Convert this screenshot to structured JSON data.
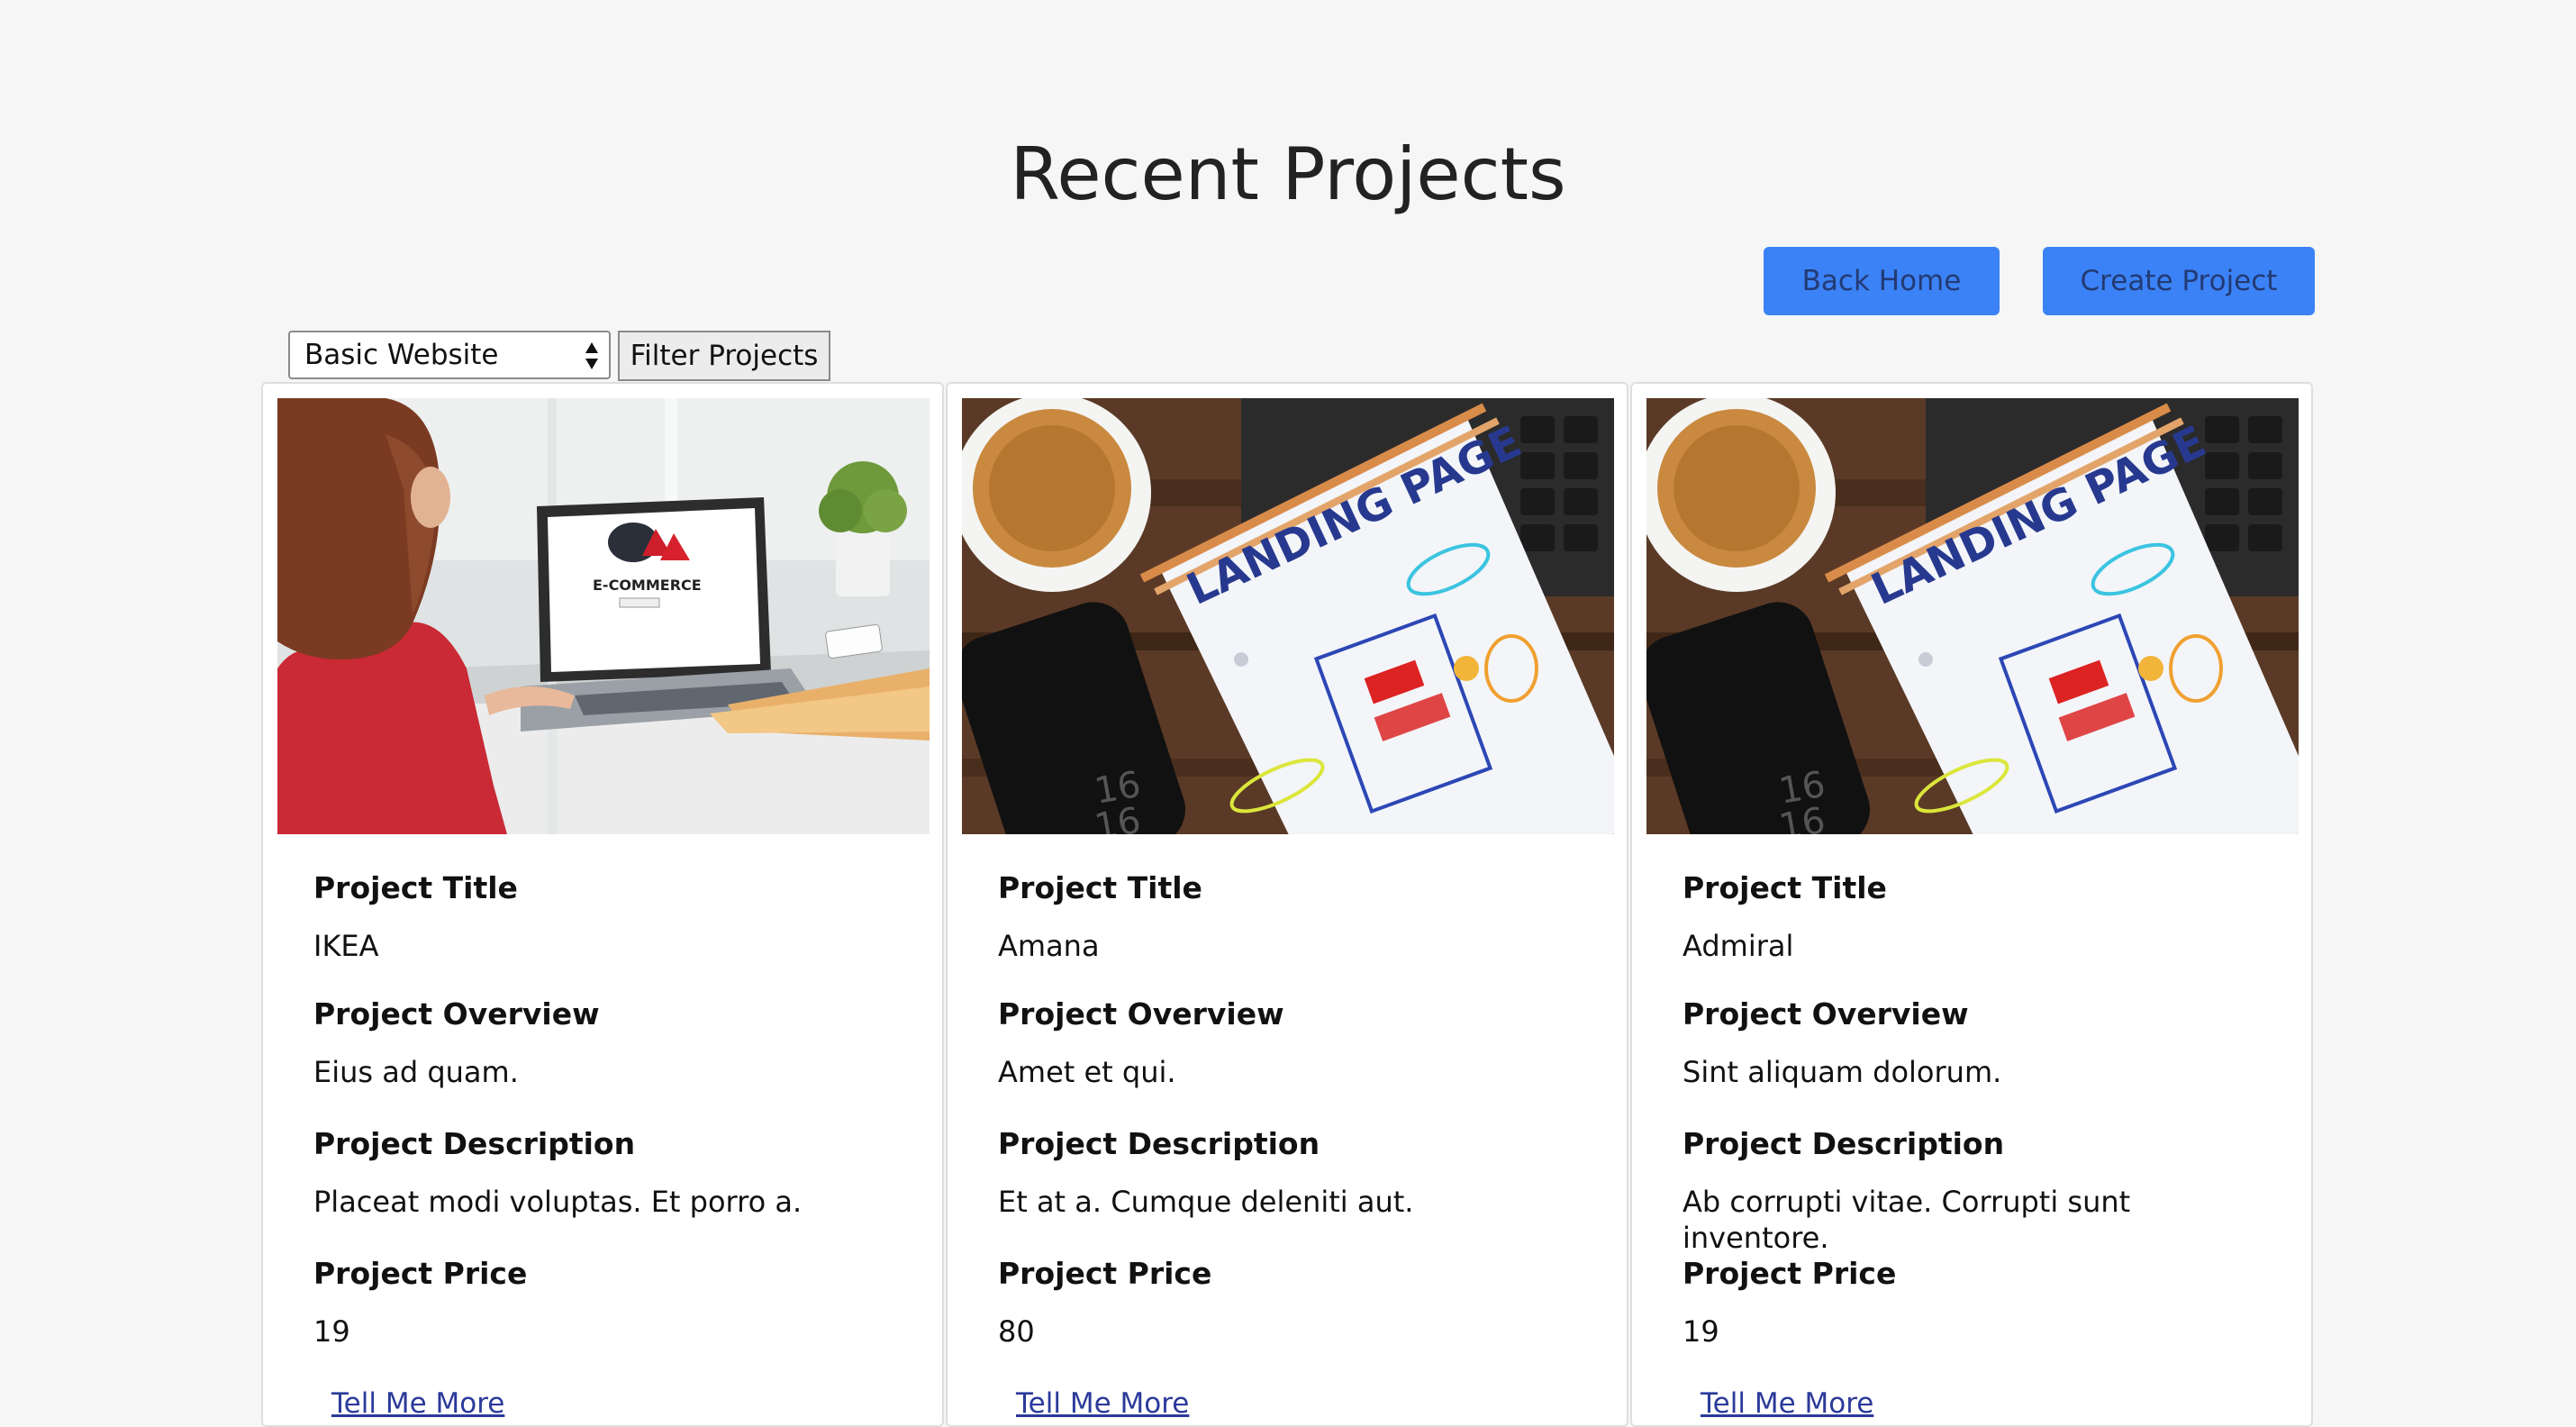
{
  "page": {
    "title": "Recent Projects"
  },
  "toolbar": {
    "back_home_label": "Back Home",
    "create_project_label": "Create Project"
  },
  "filter": {
    "selected_option": "Basic Website",
    "button_label": "Filter Projects"
  },
  "labels": {
    "project_title": "Project Title",
    "project_overview": "Project Overview",
    "project_description": "Project Description",
    "project_price": "Project Price",
    "tell_me_more": "Tell Me More"
  },
  "projects": [
    {
      "title": "IKEA",
      "overview": "Eius ad quam.",
      "description": "Placeat modi voluptas. Et porro a.",
      "price": "19",
      "image_caption": "E-COMMERCE"
    },
    {
      "title": "Amana",
      "overview": "Amet et qui.",
      "description": "Et at a. Cumque deleniti aut.",
      "price": "80",
      "image_caption": "LANDING PAGE"
    },
    {
      "title": "Admiral",
      "overview": "Sint aliquam dolorum.",
      "description": "Ab corrupti vitae. Corrupti sunt inventore.",
      "price": "19",
      "image_caption": "LANDING PAGE"
    }
  ],
  "colors": {
    "accent_button": "#3b82f6",
    "background": "#f5f6f5",
    "link": "#2b3a9a"
  }
}
